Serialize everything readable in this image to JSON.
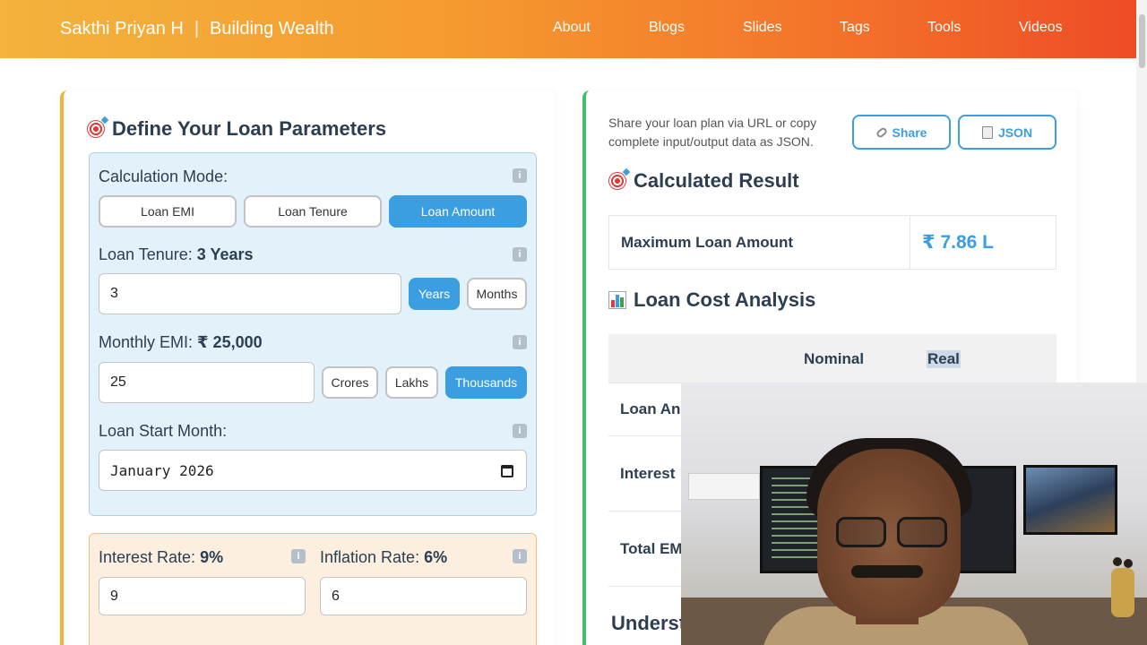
{
  "header": {
    "brand_name": "Sakthi Priyan H",
    "brand_separator": "|",
    "brand_tagline": "Building Wealth",
    "nav": [
      "About",
      "Blogs",
      "Slides",
      "Tags",
      "Tools",
      "Videos"
    ],
    "gradient_start": "#f3b33d",
    "gradient_end": "#ee4a25"
  },
  "left_card": {
    "title": "Define Your Loan Parameters",
    "calc_mode_label": "Calculation Mode:",
    "modes": [
      "Loan EMI",
      "Loan Tenure",
      "Loan Amount"
    ],
    "active_mode": "Loan Amount",
    "tenure_label": "Loan Tenure: ",
    "tenure_value_text": "3 Years",
    "tenure_input": "3",
    "tenure_units": [
      "Years",
      "Months"
    ],
    "active_tenure_unit": "Years",
    "emi_label": "Monthly EMI: ",
    "emi_value_text": "₹ 25,000",
    "emi_input": "25",
    "emi_units": [
      "Crores",
      "Lakhs",
      "Thousands"
    ],
    "active_emi_unit": "Thousands",
    "start_label": "Loan Start Month:",
    "start_input": "January 2026",
    "interest_label": "Interest Rate: ",
    "interest_value_text": "9%",
    "interest_input": "9",
    "inflation_label": "Inflation Rate: ",
    "inflation_value_text": "6%",
    "inflation_input": "6",
    "info_glyph": "i"
  },
  "right_card": {
    "share_text": "Share your loan plan via URL or copy complete input/output data as JSON.",
    "share_button": "Share",
    "json_button": "JSON",
    "result_title": "Calculated Result",
    "result_label": "Maximum Loan Amount",
    "result_value": "₹ 7.86 L",
    "analysis_title": "Loan Cost Analysis",
    "col_nominal": "Nominal",
    "col_real": "Real",
    "rows": [
      "Loan An",
      "Interest",
      "Total EM"
    ],
    "understand_heading": "Underst"
  },
  "webcam": {
    "description_icon": "presenter-webcam"
  }
}
